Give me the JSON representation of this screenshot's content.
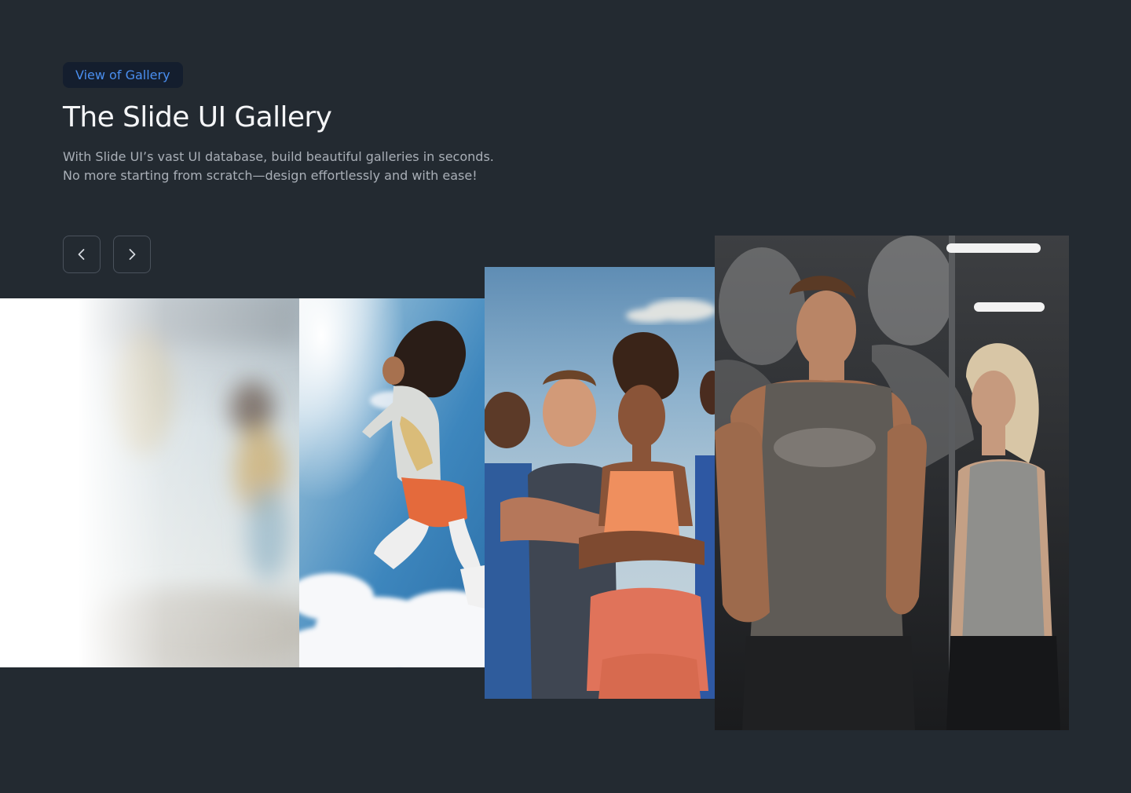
{
  "header": {
    "badge": "View of Gallery",
    "title": "The Slide UI Gallery",
    "description_lines": [
      "With Slide UI’s vast UI database, build beautiful galleries in seconds.",
      "No more starting from scratch—design effortlessly and with ease!"
    ]
  },
  "navigation": {
    "prev_icon": "chevron-left-icon",
    "next_icon": "chevron-right-icon"
  },
  "gallery": {
    "slides": [
      {
        "subject": "blurred-runner-photo"
      },
      {
        "subject": "woman-running-against-sky-photo"
      },
      {
        "subject": "group-of-athletes-photo"
      },
      {
        "subject": "gym-man-and-woman-photo"
      }
    ]
  },
  "colors": {
    "background": "#232a31",
    "badge_background": "#141e2e",
    "badge_text": "#4a8ff0",
    "title": "#f4f5f7",
    "description": "#a9afb7",
    "button_border": "#4a525c"
  }
}
